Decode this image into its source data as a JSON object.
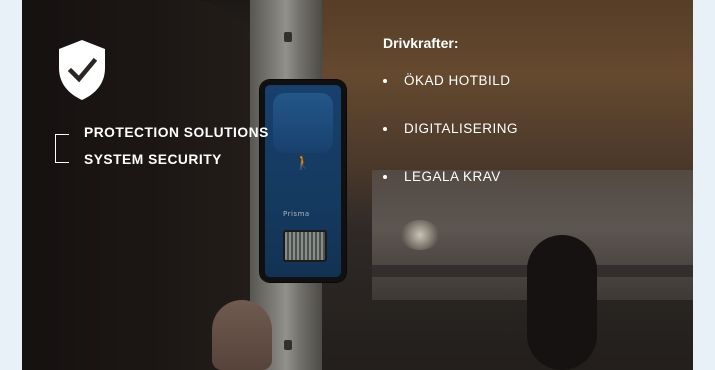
{
  "header": {
    "line1": "PROTECTION SOLUTIONS",
    "line2": "SYSTEM SECURITY"
  },
  "drivers": {
    "title": "Drivkrafter:",
    "items": [
      {
        "label": "ÖKAD HOTBILD"
      },
      {
        "label": "DIGITALISERING"
      },
      {
        "label": "LEGALA KRAV"
      }
    ]
  },
  "device": {
    "brand": "Prisma"
  },
  "colors": {
    "page_bg": "#e7f1f7",
    "text": "#ffffff",
    "device_blue": "#1e4f86"
  },
  "icons": {
    "logo": "shield-check-icon",
    "bracket": "bracket-icon",
    "bullet": "bullet-dot-icon"
  }
}
